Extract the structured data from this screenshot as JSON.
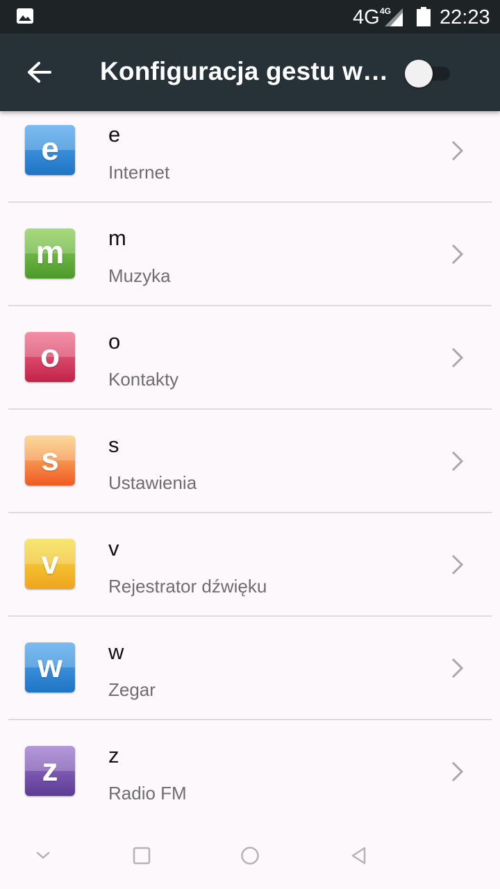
{
  "status_bar": {
    "network": "4G",
    "network_small": "4G",
    "time": "22:23",
    "icons": [
      "image-icon",
      "signal-icon",
      "battery-icon"
    ]
  },
  "app_bar": {
    "title": "Konfiguracja gestu w…",
    "master_switch_on": false,
    "back_icon": "arrow-back-icon"
  },
  "colors": {
    "app_bar_bg": "#263238",
    "status_bar_bg": "#1e2426",
    "page_bg": "#fcf8fc"
  },
  "gestures": [
    {
      "letter": "e",
      "app": "Internet",
      "icon_color": "#2a86d6"
    },
    {
      "letter": "m",
      "app": "Muzyka",
      "icon_color": "#5fa83a"
    },
    {
      "letter": "o",
      "app": "Kontakty",
      "icon_color": "#d63d63"
    },
    {
      "letter": "s",
      "app": "Ustawienia",
      "icon_color": "#f37a33"
    },
    {
      "letter": "v",
      "app": "Rejestrator dźwięku",
      "icon_color": "#f0b825"
    },
    {
      "letter": "w",
      "app": "Zegar",
      "icon_color": "#2a86d6"
    },
    {
      "letter": "z",
      "app": "Radio FM",
      "icon_color": "#7a4ea8"
    }
  ],
  "nav_bar": {
    "buttons": [
      "chevron-down-icon",
      "recents-square-icon",
      "home-circle-icon",
      "back-triangle-icon"
    ]
  }
}
